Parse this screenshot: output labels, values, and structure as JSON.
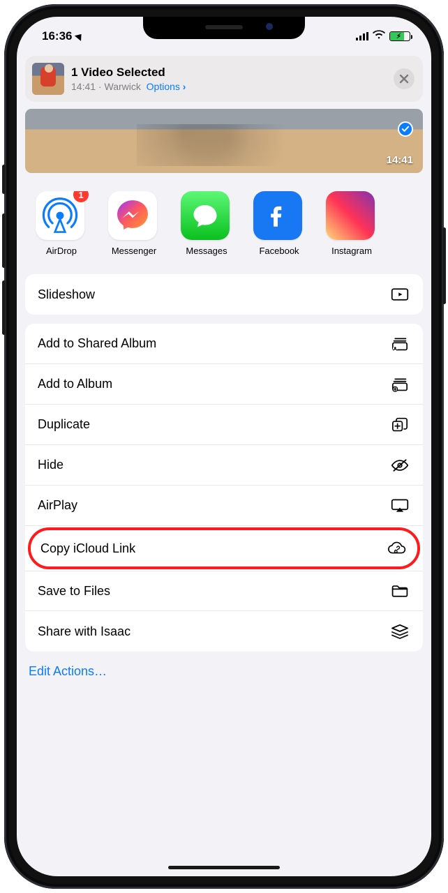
{
  "status": {
    "time": "16:36"
  },
  "header": {
    "title": "1 Video Selected",
    "subtitle_time": "14:41",
    "subtitle_sep": " · ",
    "subtitle_loc": "Warwick",
    "options_label": "Options",
    "options_chevron": "›"
  },
  "preview": {
    "duration": "14:41"
  },
  "apps": [
    {
      "name": "AirDrop",
      "badge": "1"
    },
    {
      "name": "Messenger",
      "badge": ""
    },
    {
      "name": "Messages",
      "badge": ""
    },
    {
      "name": "Facebook",
      "badge": ""
    },
    {
      "name": "Instagram",
      "badge": ""
    }
  ],
  "actions": {
    "slideshow": "Slideshow",
    "add_shared_album": "Add to Shared Album",
    "add_album": "Add to Album",
    "duplicate": "Duplicate",
    "hide": "Hide",
    "airplay": "AirPlay",
    "copy_icloud": "Copy iCloud Link",
    "save_files": "Save to Files",
    "share_contact": "Share with Isaac"
  },
  "edit_actions_label": "Edit Actions…"
}
